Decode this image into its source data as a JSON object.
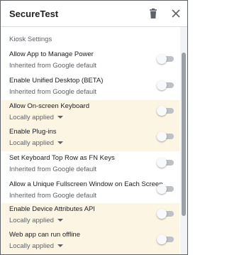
{
  "header": {
    "title": "SecureTest"
  },
  "icons": {
    "delete": "trash-icon",
    "close": "close-icon"
  },
  "section": {
    "title": "Kiosk Settings"
  },
  "colors": {
    "highlight_row": "#fdf5e3",
    "toggle_track": "#bdc1c6"
  },
  "settings": [
    {
      "label": "Allow App to Manage Power",
      "sub": "Inherited from Google default",
      "on": false
    },
    {
      "label": "Enable Unified Desktop (BETA)",
      "sub": "Inherited from Google default",
      "on": false
    },
    {
      "label": "Allow On-screen Keyboard",
      "sub": "Locally applied",
      "on": false
    },
    {
      "label": "Enable Plug-ins",
      "sub": "Locally applied",
      "on": false
    },
    {
      "label": "Set Keyboard Top Row as FN Keys",
      "sub": "Inherited from Google default",
      "on": false
    },
    {
      "label": "Allow a Unique Fullscreen Window on Each Screen",
      "sub": "Inherited from Google default",
      "on": false
    },
    {
      "label": "Enable Device Attributes API",
      "sub": "Locally applied",
      "on": false
    },
    {
      "label": "Web app can run offline",
      "sub": "Locally applied",
      "on": false
    }
  ]
}
